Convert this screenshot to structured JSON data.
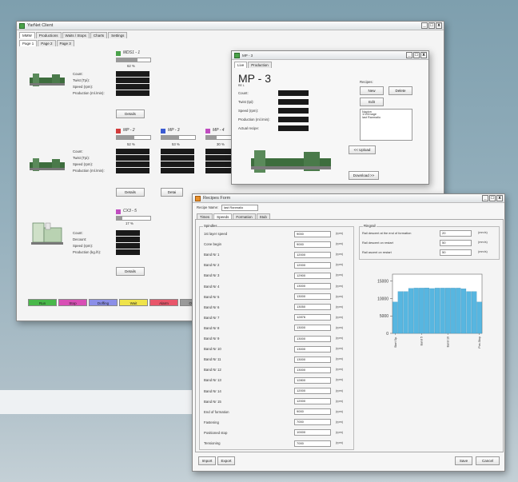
{
  "client": {
    "title": "YarNet Client",
    "menu": [
      "MMW",
      "Productions",
      "Waits / Stops",
      "Charts",
      "Settings"
    ],
    "pages": [
      "Page 1",
      "Page 2",
      "Page 3"
    ],
    "row1": {
      "name": "MDS1 - 1",
      "percent": "62 %",
      "percent_value": 0.62,
      "details": "Details"
    },
    "row2": [
      {
        "name": "MP - 2",
        "percent": "52 %",
        "percent_value": 0.52,
        "color": "#d23b3b"
      },
      {
        "name": "MP - 3",
        "percent": "53 %",
        "percent_value": 0.53,
        "color": "#3b5bd2"
      },
      {
        "name": "MP - 4",
        "percent": "30 %",
        "percent_value": 0.3,
        "color": "#c04cc0"
      }
    ],
    "row2_details": [
      "Details",
      "Detai"
    ],
    "row3": {
      "name": "CX3 - 5",
      "percent": "17 %",
      "percent_value": 0.17,
      "details": "Details"
    },
    "labels_a": [
      "Count:",
      "Twist (Tpi):",
      "Speed (rpm):",
      "Production (ml./min):"
    ],
    "labels_c": [
      "Count:",
      "Decount:",
      "Speed (rpm):",
      "Production (kg./h):"
    ],
    "status": [
      {
        "label": "Run",
        "color": "#49b84a"
      },
      {
        "label": "Stop",
        "color": "#d84fb5"
      },
      {
        "label": "Doffing",
        "color": "#8b8fe8"
      },
      {
        "label": "Wait",
        "color": "#efe34a"
      },
      {
        "label": "Alarm",
        "color": "#e8566a"
      },
      {
        "label": "Offline",
        "color": "#9a9a9a"
      }
    ]
  },
  "mp3_window": {
    "title": "MP - 3",
    "tabs": [
      "Live",
      "Production"
    ],
    "heading": "MP - 3",
    "subheading": "RE   L",
    "fields": [
      "Count:",
      "Twist (tpi):",
      "Speed (rpm):",
      "Production (ml./min):",
      "Actual recipe:"
    ],
    "recipes_label": "Recipes:",
    "buttons": {
      "new": "New",
      "delete": "Delete",
      "edit": "Edit",
      "upload": "<< Upload",
      "download": "Download >>"
    },
    "recipe_list": [
      "Naylon",
      "1/10Image",
      "last Ranmalio"
    ]
  },
  "recipes_window": {
    "title": "Recipes Form",
    "recipe_name_label": "Recipe Name:",
    "recipe_name_value": "last Ranmalio",
    "tabs": [
      "Times",
      "Speeds",
      "Formation",
      "Stub"
    ],
    "spindles_title": "Spindles",
    "rows": [
      {
        "label": "1st layer speed",
        "value": "9000",
        "unit": "(rpm)"
      },
      {
        "label": "Cone begin",
        "value": "9000",
        "unit": "(rpm)"
      },
      {
        "label": "Band Nr 1",
        "value": "12000",
        "unit": "(rpm)"
      },
      {
        "label": "Band Nr 2",
        "value": "12000",
        "unit": "(rpm)"
      },
      {
        "label": "Band Nr 3",
        "value": "12900",
        "unit": "(rpm)"
      },
      {
        "label": "Band Nr 4",
        "value": "13000",
        "unit": "(rpm)"
      },
      {
        "label": "Band Nr 5",
        "value": "13000",
        "unit": "(rpm)"
      },
      {
        "label": "Band Nr 6",
        "value": "13050",
        "unit": "(rpm)"
      },
      {
        "label": "Band Nr 7",
        "value": "12876",
        "unit": "(rpm)"
      },
      {
        "label": "Band Nr 8",
        "value": "13000",
        "unit": "(rpm)"
      },
      {
        "label": "Band Nr 9",
        "value": "13000",
        "unit": "(rpm)"
      },
      {
        "label": "Band Nr 10",
        "value": "13000",
        "unit": "(rpm)"
      },
      {
        "label": "Band Nr 11",
        "value": "13000",
        "unit": "(rpm)"
      },
      {
        "label": "Band Nr 12",
        "value": "13000",
        "unit": "(rpm)"
      },
      {
        "label": "Band Nr 13",
        "value": "12800",
        "unit": "(rpm)"
      },
      {
        "label": "Band Nr 14",
        "value": "12000",
        "unit": "(rpm)"
      },
      {
        "label": "Band Nr 15",
        "value": "12000",
        "unit": "(rpm)"
      },
      {
        "label": "End of formation",
        "value": "9000",
        "unit": "(rpm)"
      },
      {
        "label": "Fastening",
        "value": "7000",
        "unit": "(rpm)"
      },
      {
        "label": "Positioned stop",
        "value": "10000",
        "unit": "(rpm)"
      },
      {
        "label": "Tensioning",
        "value": "7000",
        "unit": "(rpm)"
      }
    ],
    "ringrail_title": "Ringrail",
    "ringrail_rows": [
      {
        "label": "Rail descent at the end of formation",
        "value": "20",
        "unit": "(mm/s)"
      },
      {
        "label": "Rail descent on restart",
        "value": "50",
        "unit": "(mm/s)"
      },
      {
        "label": "Rail ascent on restart",
        "value": "50",
        "unit": "(mm/s)"
      }
    ],
    "buttons": {
      "import": "Import",
      "export": "Export",
      "save": "Save",
      "cancel": "Cancel"
    }
  },
  "chart_data": {
    "type": "bar",
    "title": "",
    "xlabel": "",
    "ylabel": "",
    "ylim": [
      0,
      17000
    ],
    "yticks": [
      0,
      5000,
      10000,
      15000
    ],
    "ytick_labels": [
      "0",
      "5000",
      "10000",
      "15000"
    ],
    "categories": [
      "Cone begin",
      "Band Nr 1",
      "Band Nr 2",
      "Band Nr 3",
      "Band Nr 4",
      "Band Nr 5",
      "Band Nr 6",
      "Band Nr 7",
      "Band Nr 8",
      "Band Nr 9",
      "Band Nr 10",
      "Band Nr 11",
      "Band Nr 12",
      "Band Nr 13",
      "Band Nr 14",
      "Band Nr 15",
      "End of formation"
    ],
    "values": [
      9000,
      12000,
      12000,
      12900,
      13000,
      13000,
      13050,
      12876,
      13000,
      13000,
      13000,
      13000,
      13000,
      12800,
      12000,
      12000,
      9000
    ],
    "x_tick_labels": [
      "Start Sp.",
      "Band 5",
      "Band 10",
      "Pos.Stop"
    ],
    "bar_color": "#57b6e0",
    "grid": false
  }
}
